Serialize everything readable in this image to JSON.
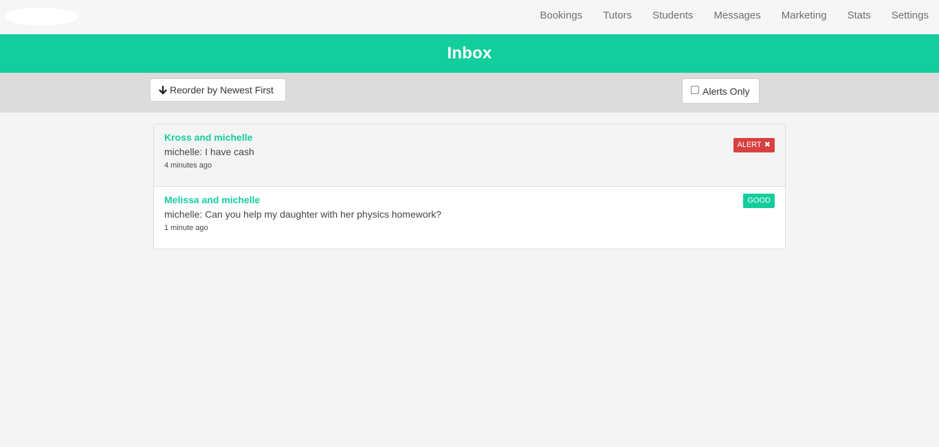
{
  "nav": {
    "links": [
      "Bookings",
      "Tutors",
      "Students",
      "Messages",
      "Marketing",
      "Stats",
      "Settings"
    ]
  },
  "header": {
    "title": "Inbox"
  },
  "toolbar": {
    "reorder_label": "Reorder by Newest First",
    "alerts_only_label": "Alerts Only",
    "alerts_only_checked": false
  },
  "conversations": [
    {
      "participants": "Kross and michelle",
      "last_message": "michelle: I have cash",
      "time": "4 minutes ago",
      "badge": "ALERT",
      "badge_icon": "times-icon",
      "status": "alert"
    },
    {
      "participants": "Melissa and michelle",
      "last_message": "michelle: Can you help my daughter with her physics homework?",
      "time": "1 minute ago",
      "badge": "GOOD",
      "status": "good"
    }
  ],
  "colors": {
    "accent": "#13cd9d",
    "alert": "#d94040",
    "toolbar_bg": "#dcdcdc",
    "page_bg": "#f4f4f4"
  }
}
